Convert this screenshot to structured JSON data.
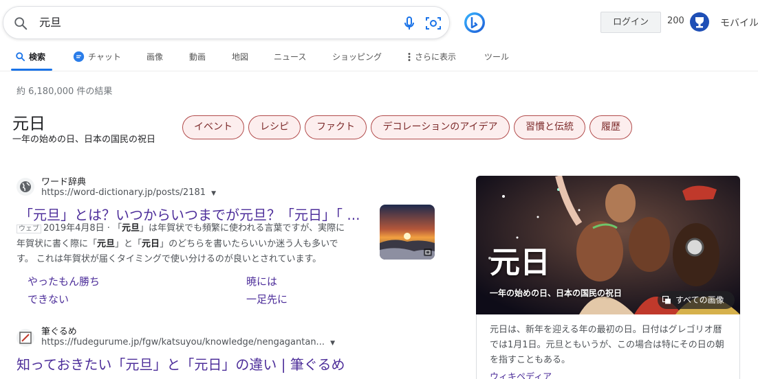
{
  "search": {
    "query": "元旦"
  },
  "header": {
    "login_label": "ログイン",
    "points": "200",
    "mobile_label": "モバイル"
  },
  "tabs": [
    {
      "label": "検索",
      "icon": "search-icon",
      "active": true
    },
    {
      "label": "チャット",
      "icon": "chat-bubble-icon"
    },
    {
      "label": "画像"
    },
    {
      "label": "動画"
    },
    {
      "label": "地図"
    },
    {
      "label": "ニュース"
    },
    {
      "label": "ショッピング"
    },
    {
      "label": "さらに表示",
      "icon": "more-vertical-icon"
    },
    {
      "label": "ツール"
    }
  ],
  "result_count": "約 6,180,000 件の結果",
  "entity": {
    "title": "元日",
    "subtitle": "一年の始めの日、日本の国民の祝日",
    "chips": [
      "イベント",
      "レシピ",
      "ファクト",
      "デコレーションのアイデア",
      "習慣と伝統",
      "履歴"
    ]
  },
  "results": [
    {
      "site_name": "ワード辞典",
      "url": "https://word-dictionary.jp/posts/2181",
      "title": "「元旦」とは？いつからいつまでが元旦？「元日」「 ...",
      "tag": "ウェブ",
      "snippet_line1_pre": "2019年4月8日 · 「",
      "snippet_line1_b": "元旦",
      "snippet_line1_post": "」は年賀状でも頻繁に使われる言葉ですが、実際に",
      "snippet_line2_pre": "年賀状に書く際に「",
      "snippet_line2_b1": "元旦",
      "snippet_line2_mid": "」と「",
      "snippet_line2_b2": "元日",
      "snippet_line2_post": "」のどちらを書いたらいいか迷う人も多いで",
      "snippet_line3": "す。 これは年賀状が届くタイミングで使い分けるのが良いとされています。",
      "sitelinks": [
        "やったもん勝ち",
        "暁には",
        "できない",
        "一足先に"
      ]
    },
    {
      "site_name": "筆ぐるめ",
      "url": "https://fudegurume.jp/fgw/katsuyou/knowledge/nengagantan...",
      "title": "知っておきたい「元旦」と「元日」の違い | 筆ぐるめ"
    }
  ],
  "knowledge_panel": {
    "image_title": "元日",
    "image_subtitle": "一年の始めの日、日本の国民の祝日",
    "all_images_label": "すべての画像",
    "description": "元日は、新年を迎える年の最初の日。日付はグレゴリオ暦では1月1日。元旦ともいうが、この場合は特にその日の朝を指すこともある。",
    "source": "ウィキペディア"
  },
  "colors": {
    "accent": "#1a73e8",
    "link": "#4d2e9a",
    "chip_border": "#b14a4a",
    "chip_bg": "#fceeee"
  }
}
